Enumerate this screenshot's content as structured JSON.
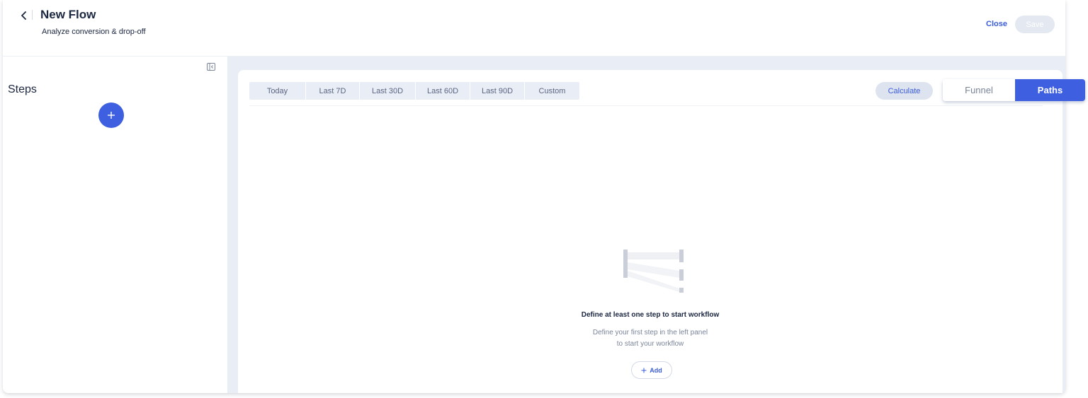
{
  "header": {
    "title": "New Flow",
    "subtitle": "Analyze conversion & drop-off",
    "close_label": "Close",
    "save_label": "Save",
    "back_icon": "chevron-left-icon"
  },
  "left_panel": {
    "steps_title": "Steps",
    "add_step_icon": "plus-icon",
    "collapse_icon": "panel-collapse-icon"
  },
  "toolbar": {
    "date_ranges": [
      "Today",
      "Last 7D",
      "Last 30D",
      "Last 60D",
      "Last 90D",
      "Custom"
    ],
    "calculate_label": "Calculate"
  },
  "view_toggle": {
    "funnel_label": "Funnel",
    "paths_label": "Paths",
    "selected": "Paths"
  },
  "empty_state": {
    "title": "Define at least one step to start workflow",
    "description_line1": "Define your first step in the left panel",
    "description_line2": "to start your workflow",
    "add_label": "Add",
    "illustration_icon": "paths-illustration-icon"
  },
  "colors": {
    "accent": "#3d5fe0",
    "link": "#3a5bd9",
    "text_dark": "#1b2640",
    "content_bg": "#e9edf6"
  }
}
